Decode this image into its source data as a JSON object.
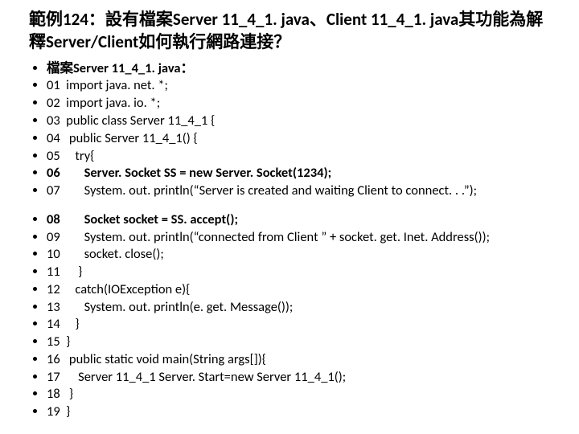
{
  "title": "範例124：設有檔案Server 11_4_1. java、Client 11_4_1. java其功能為解釋Server/Client如何執行網路連接？",
  "block1": [
    {
      "bold": true,
      "text": "檔案Server 11_4_1. java："
    },
    {
      "bold": false,
      "text": "01  import java. net. *;"
    },
    {
      "bold": false,
      "text": "02  import java. io. *;"
    },
    {
      "bold": false,
      "text": "03  public class Server 11_4_1 {"
    },
    {
      "bold": false,
      "text": "04   public Server 11_4_1() {"
    },
    {
      "bold": false,
      "text": "05     try{"
    },
    {
      "bold": true,
      "text": "06        Server. Socket SS = new Server. Socket(1234);"
    },
    {
      "bold": false,
      "text": "07        System. out. println(“Server is created and waiting Client to connect. . .”);"
    }
  ],
  "block2": [
    {
      "bold": true,
      "text": "08        Socket socket = SS. accept();"
    },
    {
      "bold": false,
      "text": "09        System. out. println(“connected from Client ” + socket. get. Inet. Address());"
    },
    {
      "bold": false,
      "text": "10        socket. close();"
    },
    {
      "bold": false,
      "text": "11      }"
    },
    {
      "bold": false,
      "text": "12     catch(IOException e){"
    },
    {
      "bold": false,
      "text": "13        System. out. println(e. get. Message());"
    },
    {
      "bold": false,
      "text": "14     }"
    },
    {
      "bold": false,
      "text": "15  }"
    },
    {
      "bold": false,
      "text": "16   public static void main(String args[]){"
    },
    {
      "bold": false,
      "text": "17      Server 11_4_1 Server. Start=new Server 11_4_1();"
    },
    {
      "bold": false,
      "text": "18   }"
    },
    {
      "bold": false,
      "text": "19  }"
    }
  ]
}
